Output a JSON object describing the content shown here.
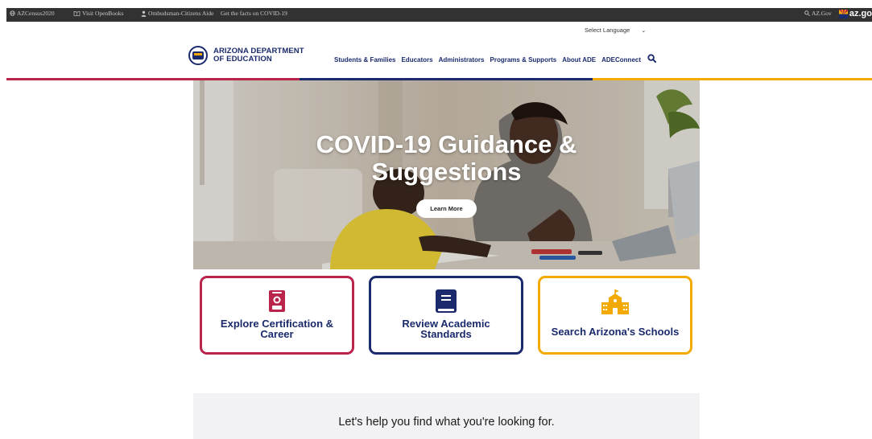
{
  "topbar": {
    "items": [
      {
        "label": "AZCensus2020"
      },
      {
        "label": "Visit OpenBooks"
      },
      {
        "label": "Ombudsman-Citizens Aide"
      },
      {
        "label": "Get the facts on COVID-19"
      }
    ],
    "az_gov_label": "AZ.Gov",
    "azgo_logo": "az.go"
  },
  "language": {
    "label": "Select Language",
    "chevron": "⌄"
  },
  "logo": {
    "line1": "ARIZONA DEPARTMENT",
    "line2": "OF EDUCATION"
  },
  "nav": {
    "items": [
      {
        "label": "Students & Families"
      },
      {
        "label": "Educators"
      },
      {
        "label": "Administrators"
      },
      {
        "label": "Programs & Supports"
      },
      {
        "label": "About ADE"
      },
      {
        "label": "ADEConnect"
      }
    ]
  },
  "hero": {
    "title_line1": "COVID-19 Guidance &",
    "title_line2": "Suggestions",
    "button_label": "Learn More"
  },
  "cards": [
    {
      "line1": "Explore Certification &",
      "line2": "Career",
      "icon": "certificate-icon"
    },
    {
      "line1": "Review Academic",
      "line2": "Standards",
      "icon": "book-icon"
    },
    {
      "line1": "Search Arizona's Schools",
      "line2": "",
      "icon": "school-icon"
    }
  ],
  "help": {
    "text": "Let's help you find what you're looking for."
  },
  "colors": {
    "crimson": "#b8244a",
    "navy": "#1a2a6c",
    "gold": "#f2a900",
    "topbar": "#323232"
  }
}
